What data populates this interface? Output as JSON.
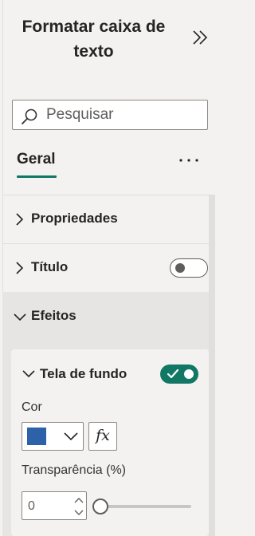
{
  "pane": {
    "title": "Formatar caixa de texto",
    "collapse_icon": "double-chevron-right-icon"
  },
  "search": {
    "placeholder": "Pesquisar",
    "icon": "search-icon"
  },
  "tabs": {
    "active_label": "Geral",
    "more_icon": "more-ellipsis-icon"
  },
  "sections": {
    "propriedades": {
      "label": "Propriedades",
      "expanded": false
    },
    "titulo": {
      "label": "Título",
      "expanded": false,
      "toggle_on": false
    },
    "efeitos": {
      "label": "Efeitos",
      "expanded": true
    }
  },
  "background_card": {
    "label": "Tela de fundo",
    "expanded": true,
    "toggle_on": true,
    "color_label": "Cor",
    "color_value": "#2e62a8",
    "fx_label": "fx",
    "transparency_label": "Transparência (%)",
    "transparency_value": "0",
    "transparency_fraction": 0
  },
  "colors": {
    "accent": "#117865",
    "panel_bg": "#f3f2f1",
    "effects_bg": "#e6e5e4"
  }
}
